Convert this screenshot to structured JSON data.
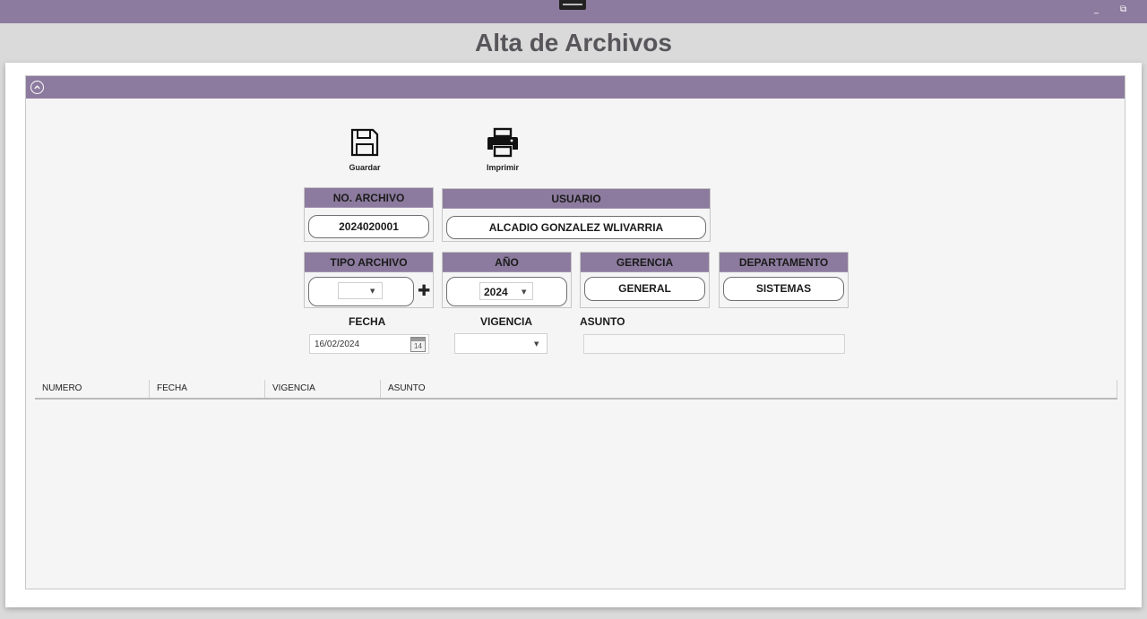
{
  "window": {
    "minimize_glyph": "_",
    "restore_glyph": "⧉"
  },
  "page": {
    "title": "Alta de Archivos"
  },
  "toolbar": {
    "save_label": "Guardar",
    "print_label": "Imprimir"
  },
  "fields": {
    "no_archivo": {
      "label": "NO. ARCHIVO",
      "value": "2024020001"
    },
    "usuario": {
      "label": "USUARIO",
      "value": "ALCADIO GONZALEZ WLIVARRIA"
    },
    "tipo_archivo": {
      "label": "TIPO ARCHIVO",
      "value": "",
      "add_glyph": "✚"
    },
    "anio": {
      "label": "AÑO",
      "value": "2024"
    },
    "gerencia": {
      "label": "GERENCIA",
      "value": "GENERAL"
    },
    "departamento": {
      "label": "DEPARTAMENTO",
      "value": "SISTEMAS"
    },
    "fecha": {
      "label": "FECHA",
      "value": "16/02/2024",
      "calendar_day": "14"
    },
    "vigencia": {
      "label": "VIGENCIA",
      "value": ""
    },
    "asunto": {
      "label": "ASUNTO",
      "value": ""
    }
  },
  "grid": {
    "columns": [
      "NUMERO",
      "FECHA",
      "VIGENCIA",
      "ASUNTO"
    ],
    "rows": []
  },
  "icons": {
    "collapse": "chevron-up-circle-icon",
    "save": "floppy-disk-icon",
    "print": "printer-icon",
    "calendar": "calendar-icon",
    "add": "plus-icon"
  },
  "colors": {
    "accent": "#8c7b9e",
    "title": "#58565b"
  }
}
